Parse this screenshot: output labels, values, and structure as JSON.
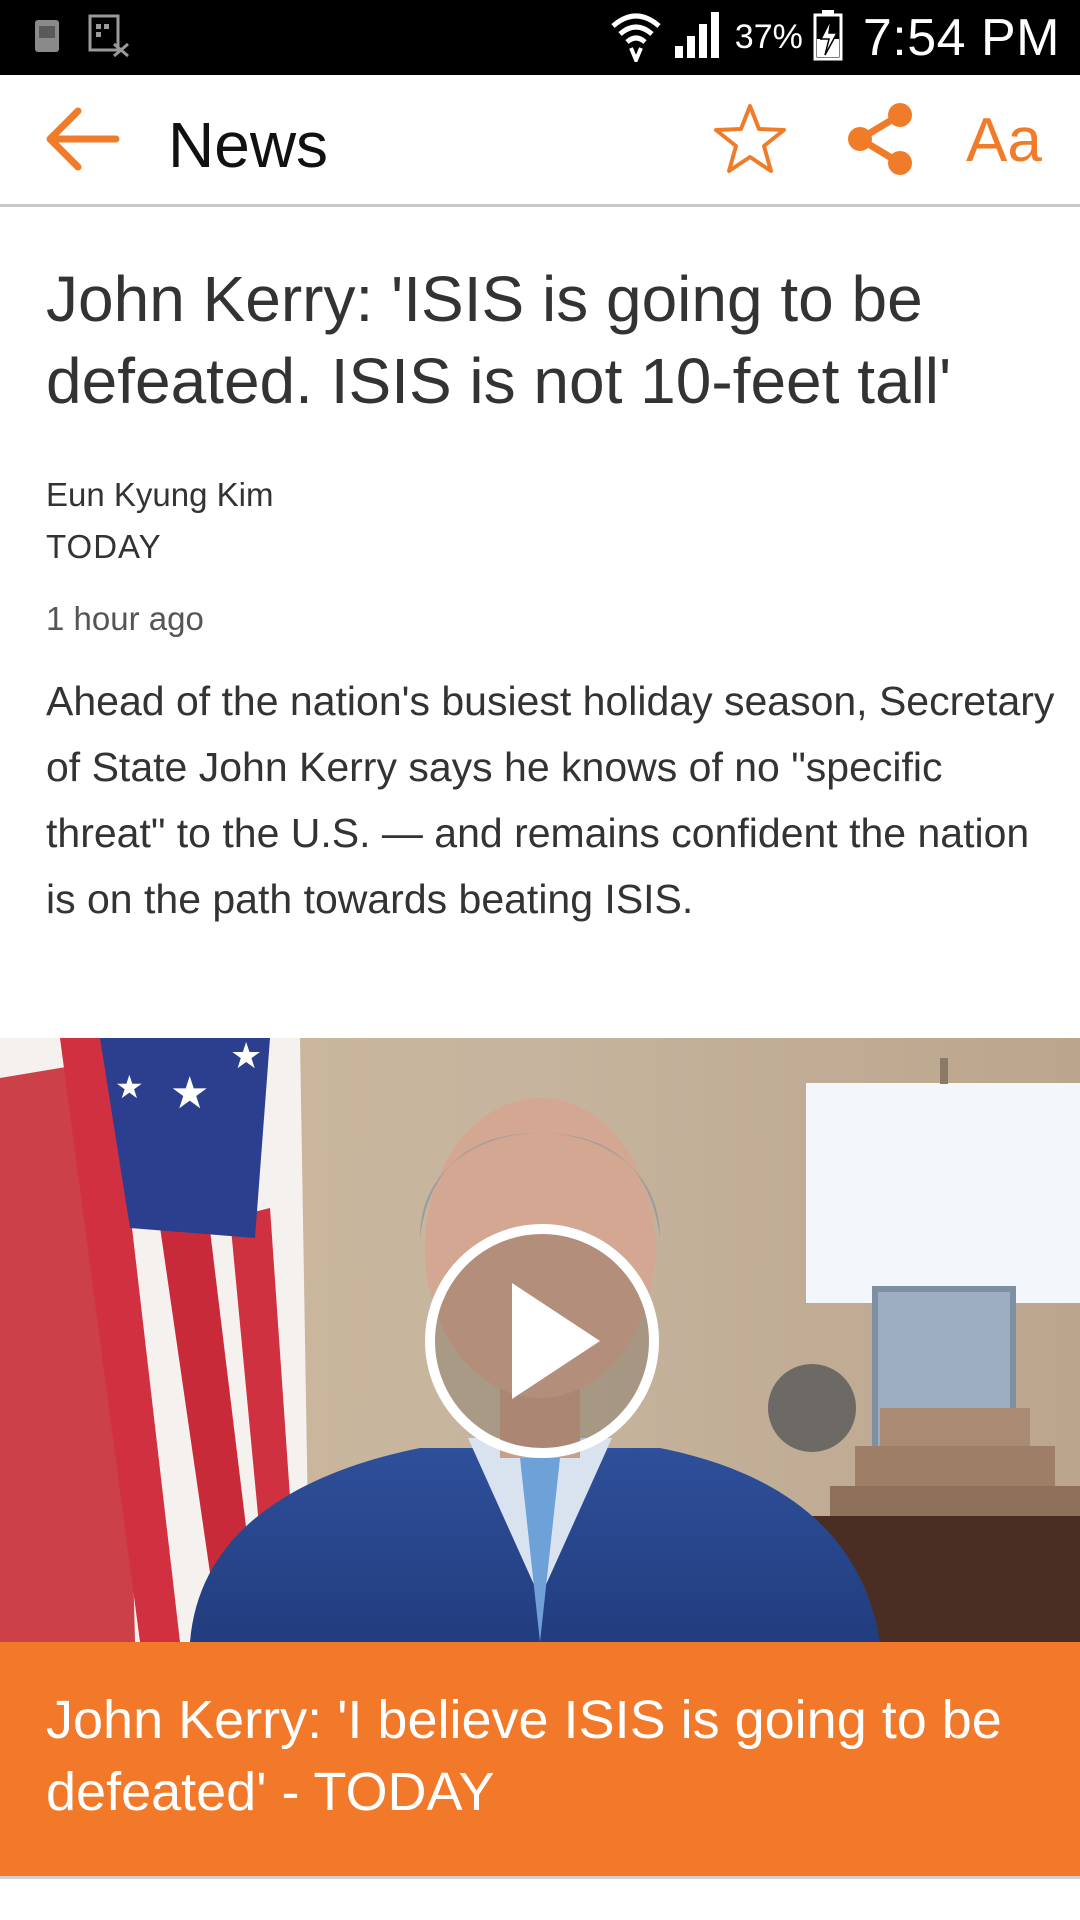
{
  "status_bar": {
    "battery_percent": "37%",
    "time": "7:54 PM",
    "icons": [
      "notification-phone-icon",
      "notification-blocked-icon",
      "wifi-icon",
      "signal-icon",
      "battery-charging-icon"
    ]
  },
  "app_bar": {
    "title": "News",
    "font_size_label": "Aa",
    "icons": [
      "back-arrow-icon",
      "star-icon",
      "share-icon"
    ]
  },
  "colors": {
    "accent": "#f07c2a",
    "caption_background": "#f2792a",
    "text": "#333333"
  },
  "article": {
    "headline": "John Kerry: 'ISIS is going to be defeated. ISIS is not 10-feet tall'",
    "author": "Eun Kyung Kim",
    "source": "TODAY",
    "time_ago": "1 hour ago",
    "summary": "Ahead of the nation's busiest holiday season, Secretary of State John Kerry says he knows of no \"specific threat\" to the U.S. — and remains confident the nation is on the path towards beating ISIS."
  },
  "video": {
    "caption": "John Kerry: 'I believe ISIS is going to be defeated' - TODAY",
    "icon": "play-icon"
  }
}
